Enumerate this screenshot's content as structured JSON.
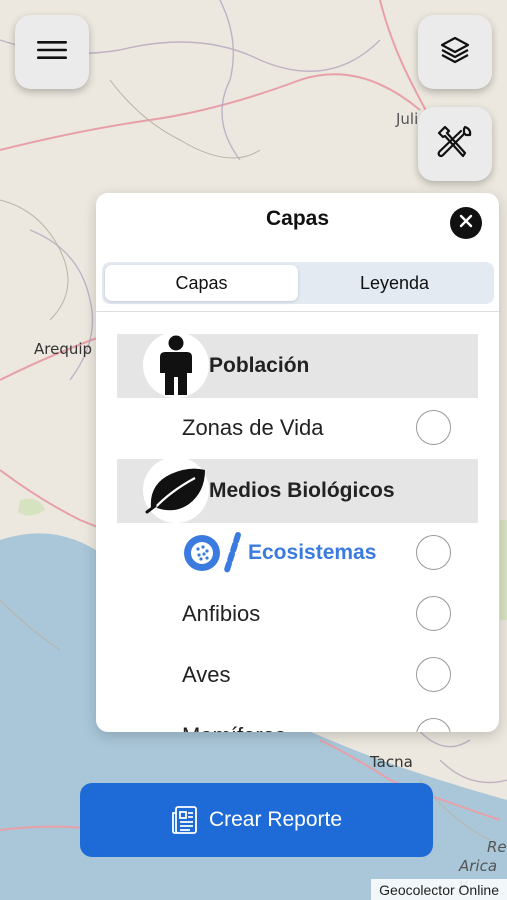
{
  "map": {
    "labels": [
      "Julia",
      "Arequip",
      "Tacna",
      "Re",
      "Arica y"
    ],
    "attribution": "Geocolector Online",
    "colors": {
      "land": "#ece8df",
      "water": "#a9c7d9",
      "roads": "#e8a0a8"
    }
  },
  "controls": {
    "menu_icon": "hamburger-menu-icon",
    "layers_icon": "layers-icon",
    "tools_icon": "tools-icon"
  },
  "panel": {
    "title": "Capas",
    "close_icon": "close-icon",
    "tabs": [
      {
        "label": "Capas",
        "active": true
      },
      {
        "label": "Leyenda",
        "active": false
      }
    ],
    "groups": [
      {
        "label": "Población",
        "icon": "person-icon",
        "items": [
          {
            "label": "Zonas de Vida"
          }
        ]
      },
      {
        "label": "Medios Biológicos",
        "icon": "leaf-icon",
        "items": [
          {
            "label": "Ecosistemas",
            "logo": "ecosistemas-logo"
          },
          {
            "label": "Anfibios"
          },
          {
            "label": "Aves"
          },
          {
            "label": "Mamíferos"
          }
        ]
      }
    ]
  },
  "report_button": {
    "label": "Crear Reporte",
    "icon": "document-icon",
    "color": "#1e6bd8"
  }
}
